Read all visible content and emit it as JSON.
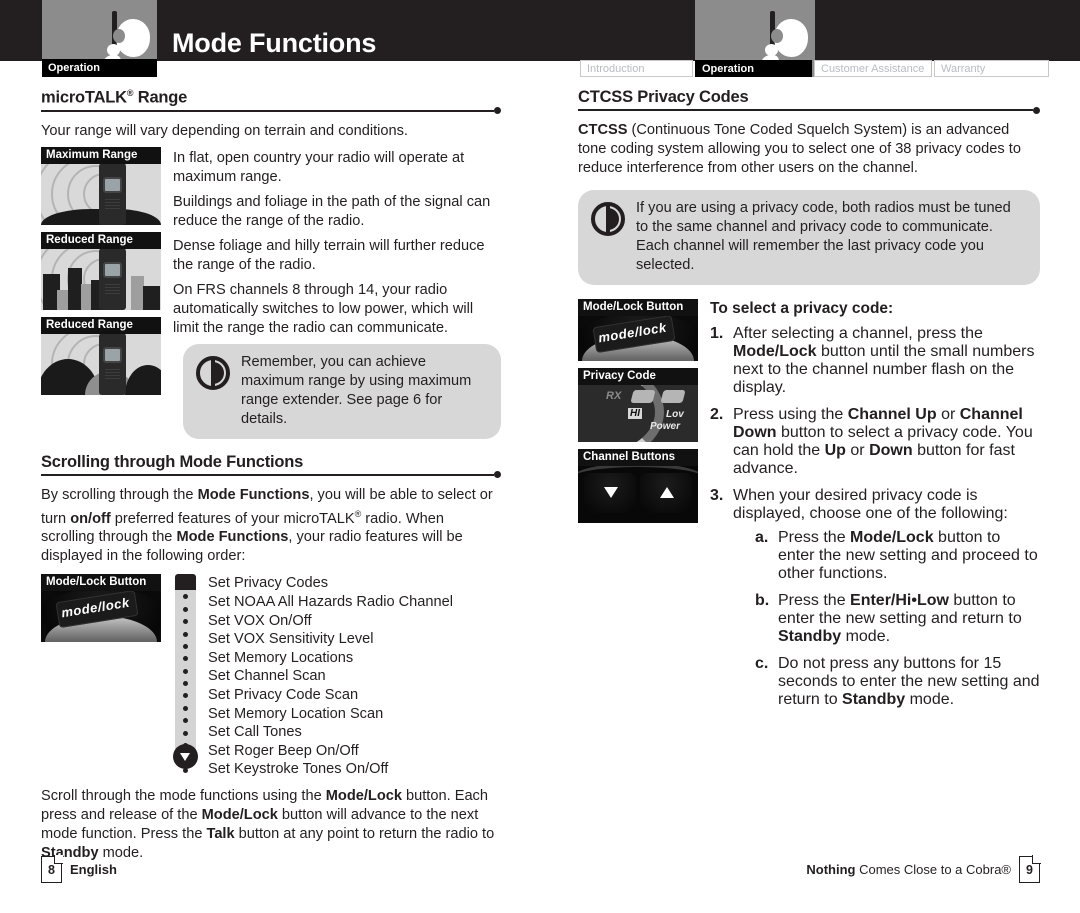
{
  "header": {
    "title": "Mode Functions",
    "left_tag": "Operation",
    "logo_name": "cobra-logo"
  },
  "tabs": [
    {
      "label": "Introduction",
      "active": false
    },
    {
      "label": "Operation",
      "active": true
    },
    {
      "label": "Customer Assistance",
      "active": false
    },
    {
      "label": "Warranty",
      "active": false
    }
  ],
  "left_column": {
    "section1": {
      "heading": "microTALK® Range",
      "intro": "Your range will vary depending on terrain and conditions.",
      "figures": [
        {
          "caption": "Maximum Range"
        },
        {
          "caption": "Reduced Range"
        },
        {
          "caption": "Reduced Range"
        }
      ],
      "paragraphs": [
        "In flat, open country your radio will operate at maximum range.",
        "Buildings and foliage in the path of the signal can reduce the range of the radio.",
        "Dense foliage and hilly terrain will further reduce the range of the radio.",
        "On FRS channels 8 through 14, your radio automatically switches to low power, which will limit the range the radio can communicate."
      ],
      "note": "Remember, you can achieve maximum range by using maximum range extender. See page 6 for details."
    },
    "section2": {
      "heading": "Scrolling through Mode Functions",
      "intro_parts": [
        {
          "text": "By scrolling through the ",
          "bold": false
        },
        {
          "text": "Mode Functions",
          "bold": true
        },
        {
          "text": ", you will be able to select or turn ",
          "bold": false
        },
        {
          "text": "on/off",
          "bold": true
        },
        {
          "text": " preferred features of your microTALK® radio. When scrolling through the ",
          "bold": false
        },
        {
          "text": "Mode Functions",
          "bold": true
        },
        {
          "text": ", your radio features will be displayed in the following order:",
          "bold": false
        }
      ],
      "figure_caption": "Mode/Lock Button",
      "figure_label": "mode/lock",
      "mode_functions": [
        "Set Privacy Codes",
        "Set NOAA All Hazards Radio Channel",
        "Set VOX On/Off",
        "Set VOX Sensitivity Level",
        "Set Memory Locations",
        "Set Channel Scan",
        "Set Privacy Code Scan",
        "Set Memory Location Scan",
        "Set Call Tones",
        "Set Roger Beep On/Off",
        "Set Keystroke Tones On/Off"
      ],
      "outro_parts": [
        {
          "text": "Scroll through the mode functions using the ",
          "bold": false
        },
        {
          "text": "Mode/Lock",
          "bold": true
        },
        {
          "text": " button. Each press and release of the ",
          "bold": false
        },
        {
          "text": "Mode/Lock",
          "bold": true
        },
        {
          "text": " button will advance to the next mode function. Press the ",
          "bold": false
        },
        {
          "text": "Talk",
          "bold": true
        },
        {
          "text": " button at any point to return the radio to ",
          "bold": false
        },
        {
          "text": "Standby",
          "bold": true
        },
        {
          "text": " mode.",
          "bold": false
        }
      ]
    }
  },
  "right_column": {
    "heading": "CTCSS Privacy Codes",
    "intro_parts": [
      {
        "text": "CTCSS",
        "bold": true
      },
      {
        "text": " (Continuous Tone Coded Squelch System) is an advanced tone coding system allowing you to select one of 38 privacy codes to reduce interference from other users on the channel.",
        "bold": false
      }
    ],
    "note": "If you are using a privacy code, both radios must be tuned to the same channel and privacy code to communicate. Each channel will remember the last privacy code you selected.",
    "figures": [
      {
        "caption": "Mode/Lock Button",
        "label": "mode/lock"
      },
      {
        "caption": "Privacy Code",
        "label": ""
      },
      {
        "caption": "Channel Buttons",
        "label": ""
      }
    ],
    "privacy_fig_text": {
      "rx": "RX",
      "hi": "HI",
      "low": "Lov",
      "power": "Power"
    },
    "subheading": "To select a privacy code:",
    "steps": [
      {
        "num": "1.",
        "parts": [
          {
            "text": "After selecting a channel, press the ",
            "bold": false
          },
          {
            "text": "Mode/Lock",
            "bold": true
          },
          {
            "text": " button until the small numbers next to the channel number flash on the display.",
            "bold": false
          }
        ]
      },
      {
        "num": "2.",
        "parts": [
          {
            "text": "Press using the ",
            "bold": false
          },
          {
            "text": "Channel Up",
            "bold": true
          },
          {
            "text": " or ",
            "bold": false
          },
          {
            "text": "Channel Down",
            "bold": true
          },
          {
            "text": " button to select a privacy code. You can hold the ",
            "bold": false
          },
          {
            "text": "Up",
            "bold": true
          },
          {
            "text": " or ",
            "bold": false
          },
          {
            "text": "Down",
            "bold": true
          },
          {
            "text": " button for fast advance.",
            "bold": false
          }
        ]
      },
      {
        "num": "3.",
        "parts": [
          {
            "text": "When your desired privacy code is displayed, choose one of the following:",
            "bold": false
          }
        ],
        "sub": [
          {
            "num": "a.",
            "parts": [
              {
                "text": "Press the ",
                "bold": false
              },
              {
                "text": "Mode/Lock",
                "bold": true
              },
              {
                "text": " button to enter the new setting and proceed to other functions.",
                "bold": false
              }
            ]
          },
          {
            "num": "b.",
            "parts": [
              {
                "text": "Press the ",
                "bold": false
              },
              {
                "text": "Enter/Hi•Low",
                "bold": true
              },
              {
                "text": " button to enter the new setting and return to ",
                "bold": false
              },
              {
                "text": "Standby",
                "bold": true
              },
              {
                "text": " mode.",
                "bold": false
              }
            ]
          },
          {
            "num": "c.",
            "parts": [
              {
                "text": "Do not press any buttons for 15 seconds to enter the new setting and return to ",
                "bold": false
              },
              {
                "text": "Standby",
                "bold": true
              },
              {
                "text": " mode.",
                "bold": false
              }
            ]
          }
        ]
      }
    ]
  },
  "footer": {
    "left_page": "8",
    "left_label": "English",
    "right_tagline_bold": "Nothing",
    "right_tagline_rest": " Comes Close to a Cobra®",
    "right_page": "9"
  },
  "colors": {
    "header_bg": "#231f20",
    "logo_box": "#8c8c8c",
    "note_bg": "#d7d7d7",
    "caption_bg": "#111111",
    "text": "#231f20",
    "tab_inactive_text": "#b7bcc2"
  }
}
